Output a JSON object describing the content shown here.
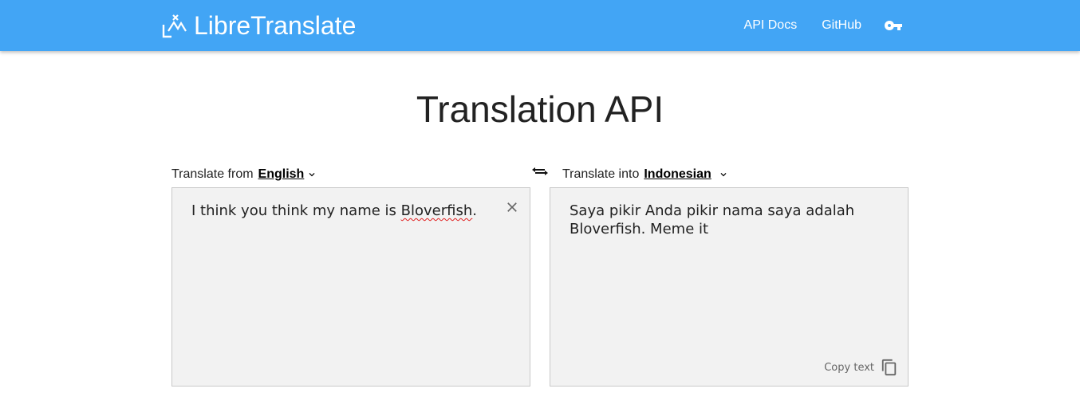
{
  "navbar": {
    "brand_name": "LibreTranslate",
    "logo_icon": "libretranslate-logo-icon",
    "links": {
      "api_docs": "API Docs",
      "github": "GitHub"
    },
    "key_icon": "key-icon",
    "color": "#42a5f5"
  },
  "page": {
    "title": "Translation API"
  },
  "source": {
    "label": "Translate from",
    "language": "English",
    "text_before": "I think you think my name is ",
    "text_misspelled": "Bloverfish",
    "text_after": ".",
    "clear_icon": "close-icon"
  },
  "swap_icon": "swap-icon",
  "target": {
    "label": "Translate into",
    "language": "Indonesian",
    "text": "Saya pikir Anda pikir nama saya adalah\nBloverfish. Meme it",
    "copy_label": "Copy text",
    "copy_icon": "copy-icon"
  },
  "colors": {
    "panel_bg": "#f2f2f2",
    "spell_error": "#e02020"
  }
}
